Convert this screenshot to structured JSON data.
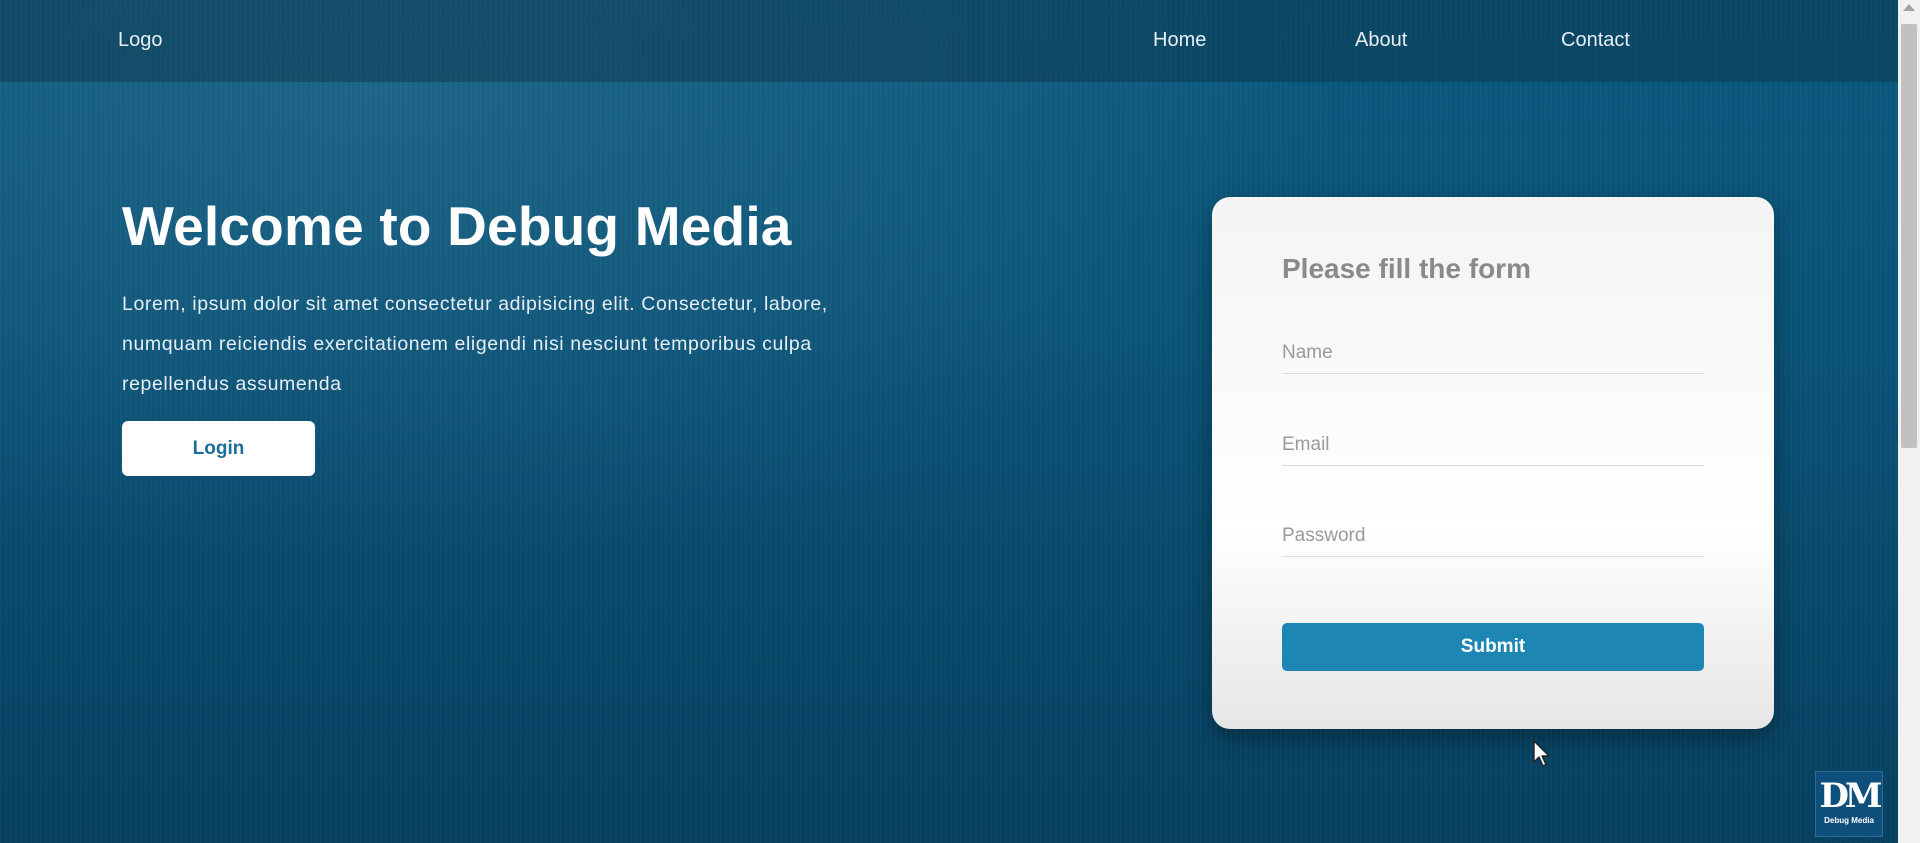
{
  "navbar": {
    "logo": "Logo",
    "links": [
      {
        "label": "Home"
      },
      {
        "label": "About"
      },
      {
        "label": "Contact"
      }
    ]
  },
  "hero": {
    "title": "Welcome to Debug Media",
    "text": "Lorem, ipsum dolor sit amet consectetur adipisicing elit. Consectetur, labore, numquam reiciendis exercitationem eligendi nisi nesciunt temporibus culpa repellendus assumenda",
    "login_label": "Login"
  },
  "form": {
    "title": "Please fill the form",
    "name_placeholder": "Name",
    "email_placeholder": "Email",
    "password_placeholder": "Password",
    "submit_label": "Submit"
  },
  "watermark": {
    "letters": "DM",
    "text": "Debug Media"
  },
  "colors": {
    "background": "#0a5479",
    "accent": "#1e86b3",
    "login_text": "#1d6f9a"
  }
}
